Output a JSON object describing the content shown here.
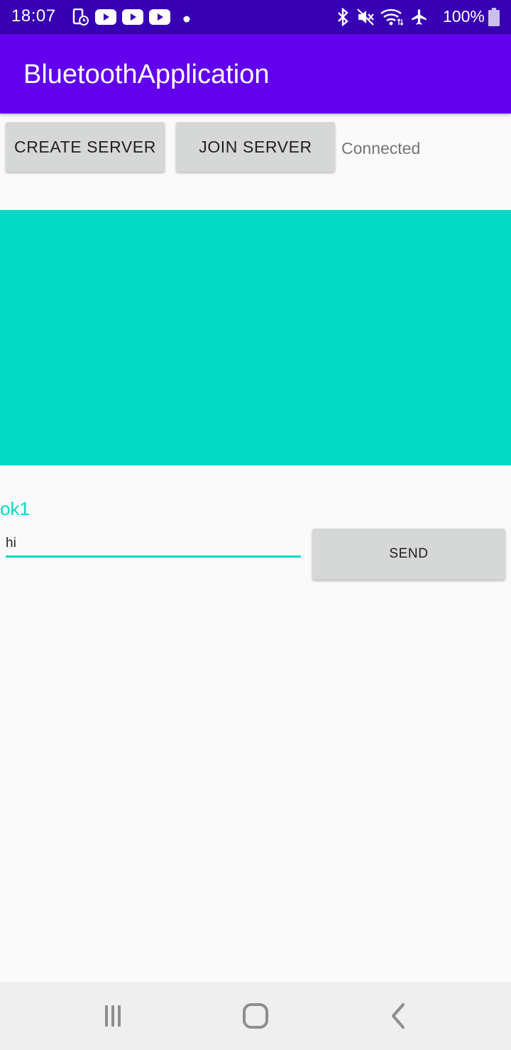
{
  "status_bar": {
    "time": "18:07",
    "battery": "100%",
    "icons": [
      "screen-record-icon",
      "youtube-icon",
      "youtube-icon",
      "youtube-icon",
      "dot-icon",
      "bluetooth-icon",
      "mute-icon",
      "wifi-icon",
      "airplane-icon",
      "battery-icon"
    ]
  },
  "app_bar": {
    "title": "BluetoothApplication"
  },
  "controls": {
    "create_label": "CREATE SERVER",
    "join_label": "JOIN SERVER",
    "status": "Connected"
  },
  "panel": {
    "color": "#03dac5"
  },
  "chat": {
    "received_message": "ok1",
    "input_value": "hi",
    "send_label": "SEND"
  },
  "colors": {
    "status_bar": "#3700b3",
    "app_bar": "#6200ee",
    "accent": "#03dac5"
  }
}
